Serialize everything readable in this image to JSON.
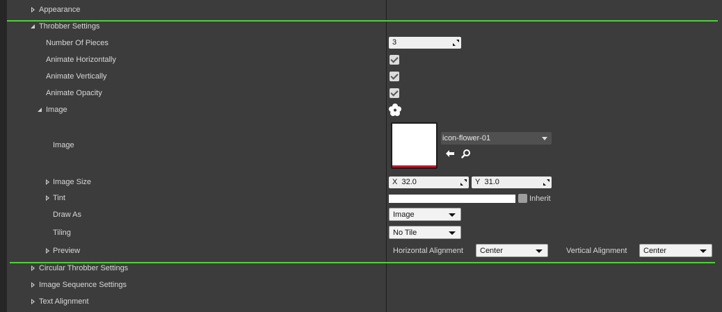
{
  "sections": {
    "appearance": "Appearance",
    "throbber_settings": "Throbber Settings",
    "circular_throbber_settings": "Circular Throbber Settings",
    "image_sequence_settings": "Image Sequence Settings",
    "text_alignment": "Text Alignment"
  },
  "properties": {
    "number_of_pieces": {
      "label": "Number Of Pieces",
      "value": "3"
    },
    "animate_horizontally": {
      "label": "Animate Horizontally",
      "checked": true
    },
    "animate_vertically": {
      "label": "Animate Vertically",
      "checked": true
    },
    "animate_opacity": {
      "label": "Animate Opacity",
      "checked": true
    },
    "image_group": {
      "label": "Image",
      "icon": "flower-icon"
    },
    "image": {
      "label": "Image",
      "asset": "icon-flower-01"
    },
    "image_size": {
      "label": "Image Size",
      "x_label": "X",
      "x_value": "32.0",
      "y_label": "Y",
      "y_value": "31.0"
    },
    "tint": {
      "label": "Tint",
      "inherit_label": "Inherit",
      "color": "#ffffff"
    },
    "draw_as": {
      "label": "Draw As",
      "value": "Image"
    },
    "tiling": {
      "label": "Tiling",
      "value": "No Tile"
    },
    "preview": {
      "label": "Preview",
      "horizontal_alignment_label": "Horizontal Alignment",
      "horizontal_alignment_value": "Center",
      "vertical_alignment_label": "Vertical Alignment",
      "vertical_alignment_value": "Center"
    }
  },
  "colors": {
    "panel_bg": "#3c3c3c",
    "highlight_green": "#4fd13a",
    "thumbnail_bottom": "#c2182b"
  }
}
